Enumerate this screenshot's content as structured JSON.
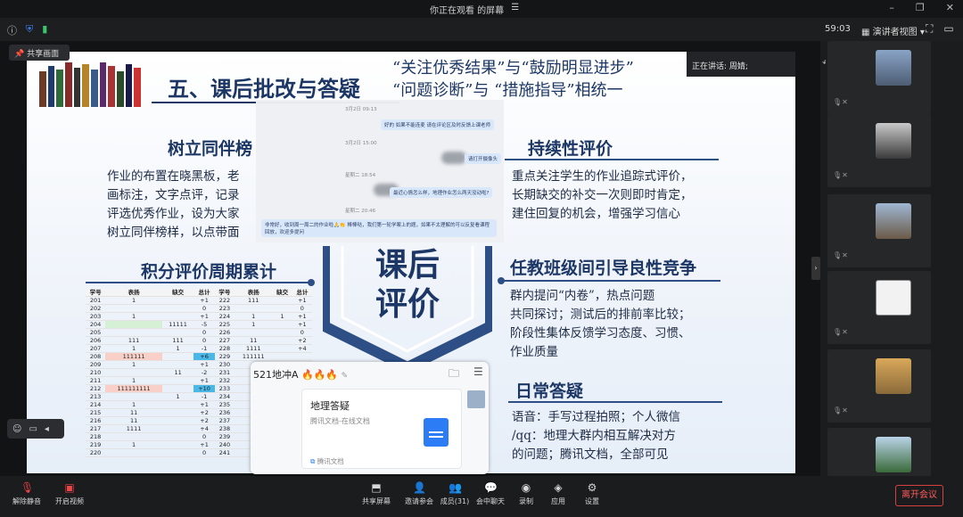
{
  "titlebar": {
    "text": "你正在观看      的屏幕",
    "menu": "☰"
  },
  "info": {
    "timer": "59:03",
    "view_label": "演讲者视图",
    "view_arrow": "▾"
  },
  "pin_label": "共享画面",
  "speaking": "正在讲话: 周婧;",
  "slide": {
    "title": "五、课后批改与答疑",
    "quote_line1": "“关注优秀结果”与“鼓励明显进步”",
    "quote_line2": "“问题诊断”与 “措施指导”相统一",
    "left_heading": "树立同伴榜",
    "left_body": [
      "作业的布置在晓黑板，老",
      "画标注，文字点评，记录",
      "评选优秀作业，设为大家",
      "树立同伴榜样，以点带面"
    ],
    "points_heading": "积分评价周期累计",
    "center_big": "课后\n评价",
    "right1_heading": "持续性评价",
    "right1_body": [
      "重点关注学生的作业追踪式评价，",
      "长期缺交的补交一次则即时肯定，",
      "建住回复的机会，增强学习信心"
    ],
    "right2_heading": "任教班级间引导良性竞争",
    "right2_body": [
      "群内提问“内卷”，热点问题",
      "共同探讨；测试后的排前率比较；",
      "阶段性集体反馈学习态度、习惯、",
      "作业质量"
    ],
    "right3_heading": "日常答疑",
    "right3_body": [
      "语音：手写过程拍照；个人微信",
      "/qq：地理大群内相互解决对方",
      "的问题；腾讯文档，全部可见"
    ]
  },
  "table": {
    "headers": [
      "学号",
      "表扬",
      "缺交",
      "总计",
      "学号",
      "表扬",
      "缺交",
      "总计"
    ],
    "rows": [
      [
        "201",
        "1",
        "",
        "+1",
        "222",
        "111",
        "",
        "+1"
      ],
      [
        "202",
        "",
        "",
        "0",
        "223",
        "",
        "",
        "0"
      ],
      [
        "203",
        "1",
        "",
        "+1",
        "224",
        "1",
        "1",
        "+1"
      ],
      [
        "204",
        "",
        "11111",
        "-5",
        "225",
        "1",
        "",
        "+1"
      ],
      [
        "205",
        "",
        "",
        "0",
        "226",
        "",
        "",
        "0"
      ],
      [
        "206",
        "111",
        "111",
        "0",
        "227",
        "11",
        "",
        "+2"
      ],
      [
        "207",
        "1",
        "1",
        "-1",
        "228",
        "1111",
        "",
        "+4"
      ],
      [
        "208",
        "111111",
        "",
        "+6",
        "229",
        "111111",
        "",
        ""
      ],
      [
        "209",
        "1",
        "",
        "+1",
        "230",
        "",
        "",
        ""
      ],
      [
        "210",
        "",
        "11",
        "-2",
        "231",
        "",
        "",
        ""
      ],
      [
        "211",
        "1",
        "",
        "+1",
        "232",
        "",
        "",
        ""
      ],
      [
        "212",
        "111111111",
        "",
        "+10",
        "233",
        "",
        "",
        ""
      ],
      [
        "213",
        "",
        "1",
        "-1",
        "234",
        "",
        "",
        ""
      ],
      [
        "214",
        "1",
        "",
        "+1",
        "235",
        "",
        "",
        ""
      ],
      [
        "215",
        "11",
        "",
        "+2",
        "236",
        "",
        "",
        ""
      ],
      [
        "216",
        "11",
        "",
        "+2",
        "237",
        "",
        "",
        ""
      ],
      [
        "217",
        "1111",
        "",
        "+4",
        "238",
        "",
        "",
        ""
      ],
      [
        "218",
        "",
        "",
        "0",
        "239",
        "",
        "",
        ""
      ],
      [
        "219",
        "1",
        "",
        "+1",
        "240",
        "",
        "",
        ""
      ],
      [
        "220",
        "",
        "",
        "0",
        "241",
        "",
        "",
        ""
      ]
    ]
  },
  "chat": {
    "ts1": "3月2日 09:13",
    "m1": "好的 如果不能连麦 请在评论区及时反馈上课老师",
    "ts2": "3月2日 15:00",
    "m2": "请打开摄像头",
    "ts3": "星期二 18:54",
    "m3": "最近心情怎么样，地理作业怎么两天没动啦?",
    "ts4": "星期二 20:46",
    "m4": "非常好，收到周一周二的作业啦🙏👏 棒棒哒，我们第一轮学案上的题，如果不太理解的可以反复看课程回放，欢迎多提问"
  },
  "doc": {
    "header": "521地冲A",
    "card_title": "地理答疑",
    "card_sub": "腾讯文档-在线文档",
    "card_foot": "腾讯文档"
  },
  "toolbar": {
    "mute": "解除静音",
    "video": "开启视频",
    "share": "共享屏幕",
    "invite": "邀请参会",
    "members": "成员(31)",
    "chat": "会中聊天",
    "record": "录制",
    "apps": "应用",
    "settings": "设置",
    "leave": "离开会议"
  }
}
